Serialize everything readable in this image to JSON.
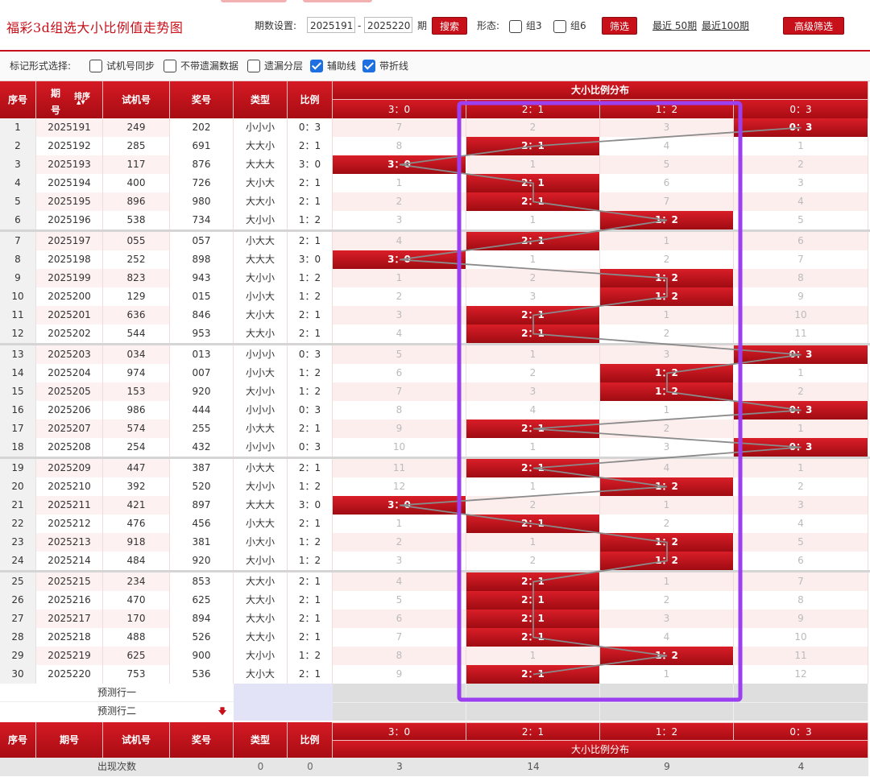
{
  "header": {
    "title": "福彩3d组选大小比例值走势图",
    "period_label": "期数设置:",
    "period_start": "2025191",
    "period_end": "2025220",
    "period_sep": "-",
    "period_unit": "期",
    "search_label": "搜索",
    "shape_label": "形态:",
    "group3_label": "组3",
    "group6_label": "组6",
    "filter_label": "筛选",
    "recent50_label": "最近 50期",
    "recent100_label": "最近100期",
    "advanced_label": "高级筛选"
  },
  "options": {
    "label": "标记形式选择:",
    "items": [
      {
        "label": "试机号同步",
        "checked": false
      },
      {
        "label": "不带遗漏数据",
        "checked": false
      },
      {
        "label": "遗漏分层",
        "checked": false
      },
      {
        "label": "辅助线",
        "checked": true
      },
      {
        "label": "带折线",
        "checked": true
      }
    ]
  },
  "table": {
    "headers": {
      "index": "序号",
      "issue_line1": "期",
      "issue_line2": "号",
      "sort": "排序",
      "test": "试机号",
      "prize": "奖号",
      "type": "类型",
      "ratio": "比例",
      "group": "大小比例分布"
    },
    "bottom_headers": {
      "index": "序号",
      "issue": "期号",
      "test": "试机号",
      "prize": "奖号",
      "type": "类型",
      "ratio": "比例",
      "group": "大小比例分布"
    },
    "dist_columns": [
      "3：0",
      "2：1",
      "1：2",
      "0：3"
    ],
    "rows": [
      {
        "idx": "1",
        "issue": "2025191",
        "test": "249",
        "prize": "202",
        "type": "小小小",
        "ratio": "0：3",
        "cells": [
          "7",
          "2",
          "3",
          "0：3"
        ]
      },
      {
        "idx": "2",
        "issue": "2025192",
        "test": "285",
        "prize": "691",
        "type": "大大小",
        "ratio": "2：1",
        "cells": [
          "8",
          "2：1",
          "4",
          "1"
        ]
      },
      {
        "idx": "3",
        "issue": "2025193",
        "test": "117",
        "prize": "876",
        "type": "大大大",
        "ratio": "3：0",
        "cells": [
          "3：0",
          "1",
          "5",
          "2"
        ]
      },
      {
        "idx": "4",
        "issue": "2025194",
        "test": "400",
        "prize": "726",
        "type": "大小大",
        "ratio": "2：1",
        "cells": [
          "1",
          "2：1",
          "6",
          "3"
        ]
      },
      {
        "idx": "5",
        "issue": "2025195",
        "test": "896",
        "prize": "980",
        "type": "大大小",
        "ratio": "2：1",
        "cells": [
          "2",
          "2：1",
          "7",
          "4"
        ]
      },
      {
        "idx": "6",
        "issue": "2025196",
        "test": "538",
        "prize": "734",
        "type": "大小小",
        "ratio": "1：2",
        "cells": [
          "3",
          "1",
          "1：2",
          "5"
        ]
      },
      {
        "idx": "7",
        "issue": "2025197",
        "test": "055",
        "prize": "057",
        "type": "小大大",
        "ratio": "2：1",
        "cells": [
          "4",
          "2：1",
          "1",
          "6"
        ]
      },
      {
        "idx": "8",
        "issue": "2025198",
        "test": "252",
        "prize": "898",
        "type": "大大大",
        "ratio": "3：0",
        "cells": [
          "3：0",
          "1",
          "2",
          "7"
        ]
      },
      {
        "idx": "9",
        "issue": "2025199",
        "test": "823",
        "prize": "943",
        "type": "大小小",
        "ratio": "1：2",
        "cells": [
          "1",
          "2",
          "1：2",
          "8"
        ]
      },
      {
        "idx": "10",
        "issue": "2025200",
        "test": "129",
        "prize": "015",
        "type": "小小大",
        "ratio": "1：2",
        "cells": [
          "2",
          "3",
          "1：2",
          "9"
        ]
      },
      {
        "idx": "11",
        "issue": "2025201",
        "test": "636",
        "prize": "846",
        "type": "大小大",
        "ratio": "2：1",
        "cells": [
          "3",
          "2：1",
          "1",
          "10"
        ]
      },
      {
        "idx": "12",
        "issue": "2025202",
        "test": "544",
        "prize": "953",
        "type": "大大小",
        "ratio": "2：1",
        "cells": [
          "4",
          "2：1",
          "2",
          "11"
        ]
      },
      {
        "idx": "13",
        "issue": "2025203",
        "test": "034",
        "prize": "013",
        "type": "小小小",
        "ratio": "0：3",
        "cells": [
          "5",
          "1",
          "3",
          "0：3"
        ]
      },
      {
        "idx": "14",
        "issue": "2025204",
        "test": "974",
        "prize": "007",
        "type": "小小大",
        "ratio": "1：2",
        "cells": [
          "6",
          "2",
          "1：2",
          "1"
        ]
      },
      {
        "idx": "15",
        "issue": "2025205",
        "test": "153",
        "prize": "920",
        "type": "大小小",
        "ratio": "1：2",
        "cells": [
          "7",
          "3",
          "1：2",
          "2"
        ]
      },
      {
        "idx": "16",
        "issue": "2025206",
        "test": "986",
        "prize": "444",
        "type": "小小小",
        "ratio": "0：3",
        "cells": [
          "8",
          "4",
          "1",
          "0：3"
        ]
      },
      {
        "idx": "17",
        "issue": "2025207",
        "test": "574",
        "prize": "255",
        "type": "小大大",
        "ratio": "2：1",
        "cells": [
          "9",
          "2：1",
          "2",
          "1"
        ]
      },
      {
        "idx": "18",
        "issue": "2025208",
        "test": "254",
        "prize": "432",
        "type": "小小小",
        "ratio": "0：3",
        "cells": [
          "10",
          "1",
          "3",
          "0：3"
        ]
      },
      {
        "idx": "19",
        "issue": "2025209",
        "test": "447",
        "prize": "387",
        "type": "小大大",
        "ratio": "2：1",
        "cells": [
          "11",
          "2：1",
          "4",
          "1"
        ]
      },
      {
        "idx": "20",
        "issue": "2025210",
        "test": "392",
        "prize": "520",
        "type": "大小小",
        "ratio": "1：2",
        "cells": [
          "12",
          "1",
          "1：2",
          "2"
        ]
      },
      {
        "idx": "21",
        "issue": "2025211",
        "test": "421",
        "prize": "897",
        "type": "大大大",
        "ratio": "3：0",
        "cells": [
          "3：0",
          "2",
          "1",
          "3"
        ]
      },
      {
        "idx": "22",
        "issue": "2025212",
        "test": "476",
        "prize": "456",
        "type": "小大大",
        "ratio": "2：1",
        "cells": [
          "1",
          "2：1",
          "2",
          "4"
        ]
      },
      {
        "idx": "23",
        "issue": "2025213",
        "test": "918",
        "prize": "381",
        "type": "小大小",
        "ratio": "1：2",
        "cells": [
          "2",
          "1",
          "1：2",
          "5"
        ]
      },
      {
        "idx": "24",
        "issue": "2025214",
        "test": "484",
        "prize": "920",
        "type": "大小小",
        "ratio": "1：2",
        "cells": [
          "3",
          "2",
          "1：2",
          "6"
        ]
      },
      {
        "idx": "25",
        "issue": "2025215",
        "test": "234",
        "prize": "853",
        "type": "大大小",
        "ratio": "2：1",
        "cells": [
          "4",
          "2：1",
          "1",
          "7"
        ]
      },
      {
        "idx": "26",
        "issue": "2025216",
        "test": "470",
        "prize": "625",
        "type": "大大小",
        "ratio": "2：1",
        "cells": [
          "5",
          "2：1",
          "2",
          "8"
        ]
      },
      {
        "idx": "27",
        "issue": "2025217",
        "test": "170",
        "prize": "894",
        "type": "大大小",
        "ratio": "2：1",
        "cells": [
          "6",
          "2：1",
          "3",
          "9"
        ]
      },
      {
        "idx": "28",
        "issue": "2025218",
        "test": "488",
        "prize": "526",
        "type": "大大小",
        "ratio": "2：1",
        "cells": [
          "7",
          "2：1",
          "4",
          "10"
        ]
      },
      {
        "idx": "29",
        "issue": "2025219",
        "test": "625",
        "prize": "900",
        "type": "大小小",
        "ratio": "1：2",
        "cells": [
          "8",
          "1",
          "1：2",
          "11"
        ]
      },
      {
        "idx": "30",
        "issue": "2025220",
        "test": "753",
        "prize": "536",
        "type": "大小大",
        "ratio": "2：1",
        "cells": [
          "9",
          "2：1",
          "1",
          "12"
        ]
      }
    ],
    "predict_row1": "预测行一",
    "predict_row2": "预测行二",
    "footer": {
      "label": "出现次数",
      "type_count": "0",
      "ratio_count": "0",
      "dist_counts": [
        "3",
        "14",
        "9",
        "4"
      ]
    }
  },
  "colors": {
    "brand_red": "#c8101a",
    "highlight_frame": "#9b3ff0",
    "trend_line": "#8a8a8a"
  }
}
